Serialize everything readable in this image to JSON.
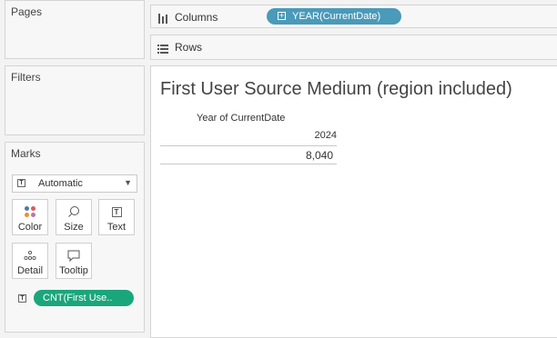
{
  "panels": {
    "pages": "Pages",
    "filters": "Filters",
    "marks": "Marks"
  },
  "marks": {
    "type": "Automatic",
    "buttons": {
      "color": "Color",
      "size": "Size",
      "text": "Text",
      "detail": "Detail",
      "tooltip": "Tooltip"
    },
    "field_pill": "CNT(First Use.."
  },
  "shelves": {
    "columns_label": "Columns",
    "rows_label": "Rows",
    "columns_pill": "YEAR(CurrentDate)"
  },
  "viz": {
    "title": "First User Source Medium (region included)",
    "column_header": "Year of CurrentDate",
    "year": "2024",
    "value": "8,040"
  },
  "colors": {
    "measure_pill": "#1aa67b",
    "dimension_pill": "#4a9ab9"
  }
}
